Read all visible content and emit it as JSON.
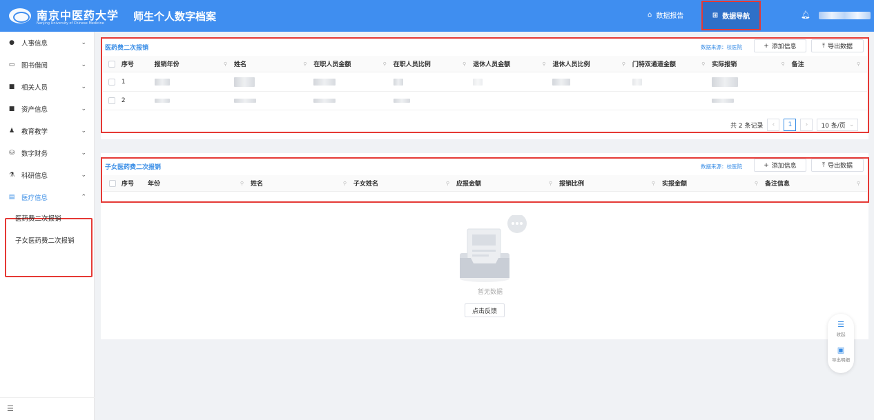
{
  "header": {
    "logo_name": "南京中医药大学",
    "logo_en": "Nanjing University of Chinese Medicine",
    "app_title": "师生个人数字档案",
    "nav_report": "数据报告",
    "nav_guide": "数据导航",
    "bell_icon": "bell-icon"
  },
  "sidebar": {
    "items": [
      {
        "label": "人事信息",
        "icon": "person-icon"
      },
      {
        "label": "图书借阅",
        "icon": "monitor-icon"
      },
      {
        "label": "相关人员",
        "icon": "contact-icon"
      },
      {
        "label": "资产信息",
        "icon": "asset-icon"
      },
      {
        "label": "教育教学",
        "icon": "teach-icon"
      },
      {
        "label": "数字财务",
        "icon": "finance-icon"
      },
      {
        "label": "科研信息",
        "icon": "research-icon"
      },
      {
        "label": "医疗信息",
        "icon": "medical-icon"
      }
    ],
    "sub_items": [
      "医药费二次报销",
      "子女医药费二次报销"
    ]
  },
  "panel1": {
    "title": "医药费二次报销",
    "source": "数据来源：校医院",
    "add_label": "添加信息",
    "export_label": "导出数据",
    "columns": [
      "序号",
      "报销年份",
      "姓名",
      "在职人员金额",
      "在职人员比例",
      "退休人员金额",
      "退休人员比例",
      "门特双通道金额",
      "实际报销",
      "备注"
    ],
    "rows": [
      {
        "index": "1"
      },
      {
        "index": "2"
      }
    ],
    "pager": {
      "total": "共 2 条记录",
      "current": "1",
      "page_size": "10 条/页"
    }
  },
  "panel2": {
    "title": "子女医药费二次报销",
    "source": "数据来源：校医院",
    "add_label": "添加信息",
    "export_label": "导出数据",
    "columns": [
      "序号",
      "年份",
      "姓名",
      "子女姓名",
      "应报金额",
      "报销比例",
      "实报金额",
      "备注信息"
    ],
    "empty_text": "暂无数据",
    "feedback_label": "点击反馈"
  },
  "float_tools": {
    "collapse_label": "收起",
    "export_detail_label": "导出明细"
  },
  "colors": {
    "header_bg": "#3f8ef0",
    "accent": "#3a8ee6",
    "highlight_border": "#e53935"
  }
}
